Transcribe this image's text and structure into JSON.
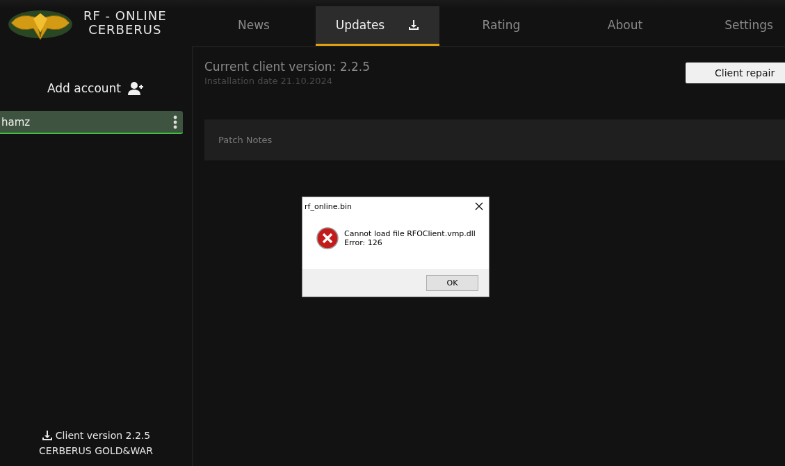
{
  "brand": {
    "line_1": "RF - ONLINE",
    "line_2": "CERBERUS"
  },
  "tabs": [
    {
      "label": "News",
      "selected": false
    },
    {
      "label": "Updates",
      "selected": true
    },
    {
      "label": "Rating",
      "selected": false
    },
    {
      "label": "About",
      "selected": false
    },
    {
      "label": "Settings",
      "selected": false
    }
  ],
  "sidebar": {
    "add_account": "Add account",
    "accounts": [
      {
        "name": "hamz",
        "selected": true
      }
    ],
    "client_version": "Client version 2.2.5",
    "server_name": "CERBERUS GOLD&WAR"
  },
  "main": {
    "version": "Current client version: 2.2.5",
    "install_date": "Installation date 21.10.2024",
    "repair_button": "Client repair",
    "patch_notes": "Patch Notes"
  },
  "dialog": {
    "title": "rf_online.bin",
    "message": "Cannot load file RFOClient.vmp.dll",
    "error": "Error: 126",
    "button": "OK"
  }
}
